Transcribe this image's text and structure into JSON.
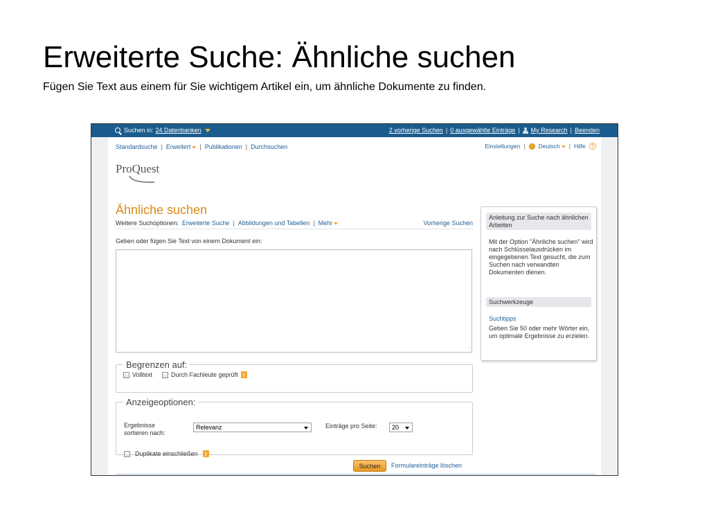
{
  "slide": {
    "title": "Erweiterte Suche: Ähnliche suchen",
    "subtitle": "Fügen Sie Text aus einem für Sie wichtigem Artikel ein, um ähnliche Dokumente zu finden."
  },
  "topbar": {
    "search_in_prefix": "Suchen in:",
    "databases_link": "24 Datenbanken",
    "previous_searches": "2 vorherige Suchen",
    "selected_entries": "0 ausgewählte Einträge",
    "my_research": "My Research",
    "logout": "Beenden",
    "separator": "|"
  },
  "nav": {
    "items": [
      "Standardsuche",
      "Erweitert",
      "Publikationen",
      "Durchsuchen"
    ],
    "separator": "|"
  },
  "util": {
    "settings": "Einstellungen",
    "language": "Deutsch",
    "help": "Hilfe",
    "help_glyph": "?"
  },
  "logo": {
    "text": "ProQuest"
  },
  "page": {
    "heading": "Ähnliche suchen"
  },
  "options": {
    "label": "Weitere Suchoptionen:",
    "advanced": "Erweiterte Suche",
    "figures": "Abbildungen und Tabellen",
    "more": "Mehr",
    "previous": "Vorherige Suchen",
    "separator": "|"
  },
  "text_input": {
    "label": "Geben oder fügen Sie Text von einem Dokument ein:",
    "value": ""
  },
  "limit": {
    "legend": "Begrenzen auf:",
    "fulltext": "Volltext",
    "peer_reviewed": "Durch Fachleute geprüft",
    "info_glyph": "i"
  },
  "display": {
    "legend": "Anzeigeoptionen:",
    "sort_label": "Ergebnisse sortieren nach:",
    "sort_value": "Relevanz",
    "per_page_label": "Einträge pro Seite:",
    "per_page_value": "20",
    "duplicates": "Duplikate einschließen",
    "info_glyph": "i"
  },
  "actions": {
    "search": "Suchen",
    "clear": "Formulareinträge löschen"
  },
  "sidebar": {
    "guide_title": "Anleitung zur Suche nach ähnlichen Arbeiten",
    "guide_text": "Mit der Option \"Ähnliche suchen\" wird nach Schlüsselausdrücken im eingegebenen Text gesucht, die zum Suchen nach verwandten Dokumenten dienen.",
    "tools_title": "Suchwerkzeuge",
    "tips_link": "Suchtipps",
    "tips_text": "Geben Sie 50 oder mehr Wörter ein, um optimale Ergebnisse zu erzielen."
  },
  "colors": {
    "topbar": "#1b5c8e",
    "accent_orange": "#d98a19",
    "link_blue": "#1f5f99"
  }
}
